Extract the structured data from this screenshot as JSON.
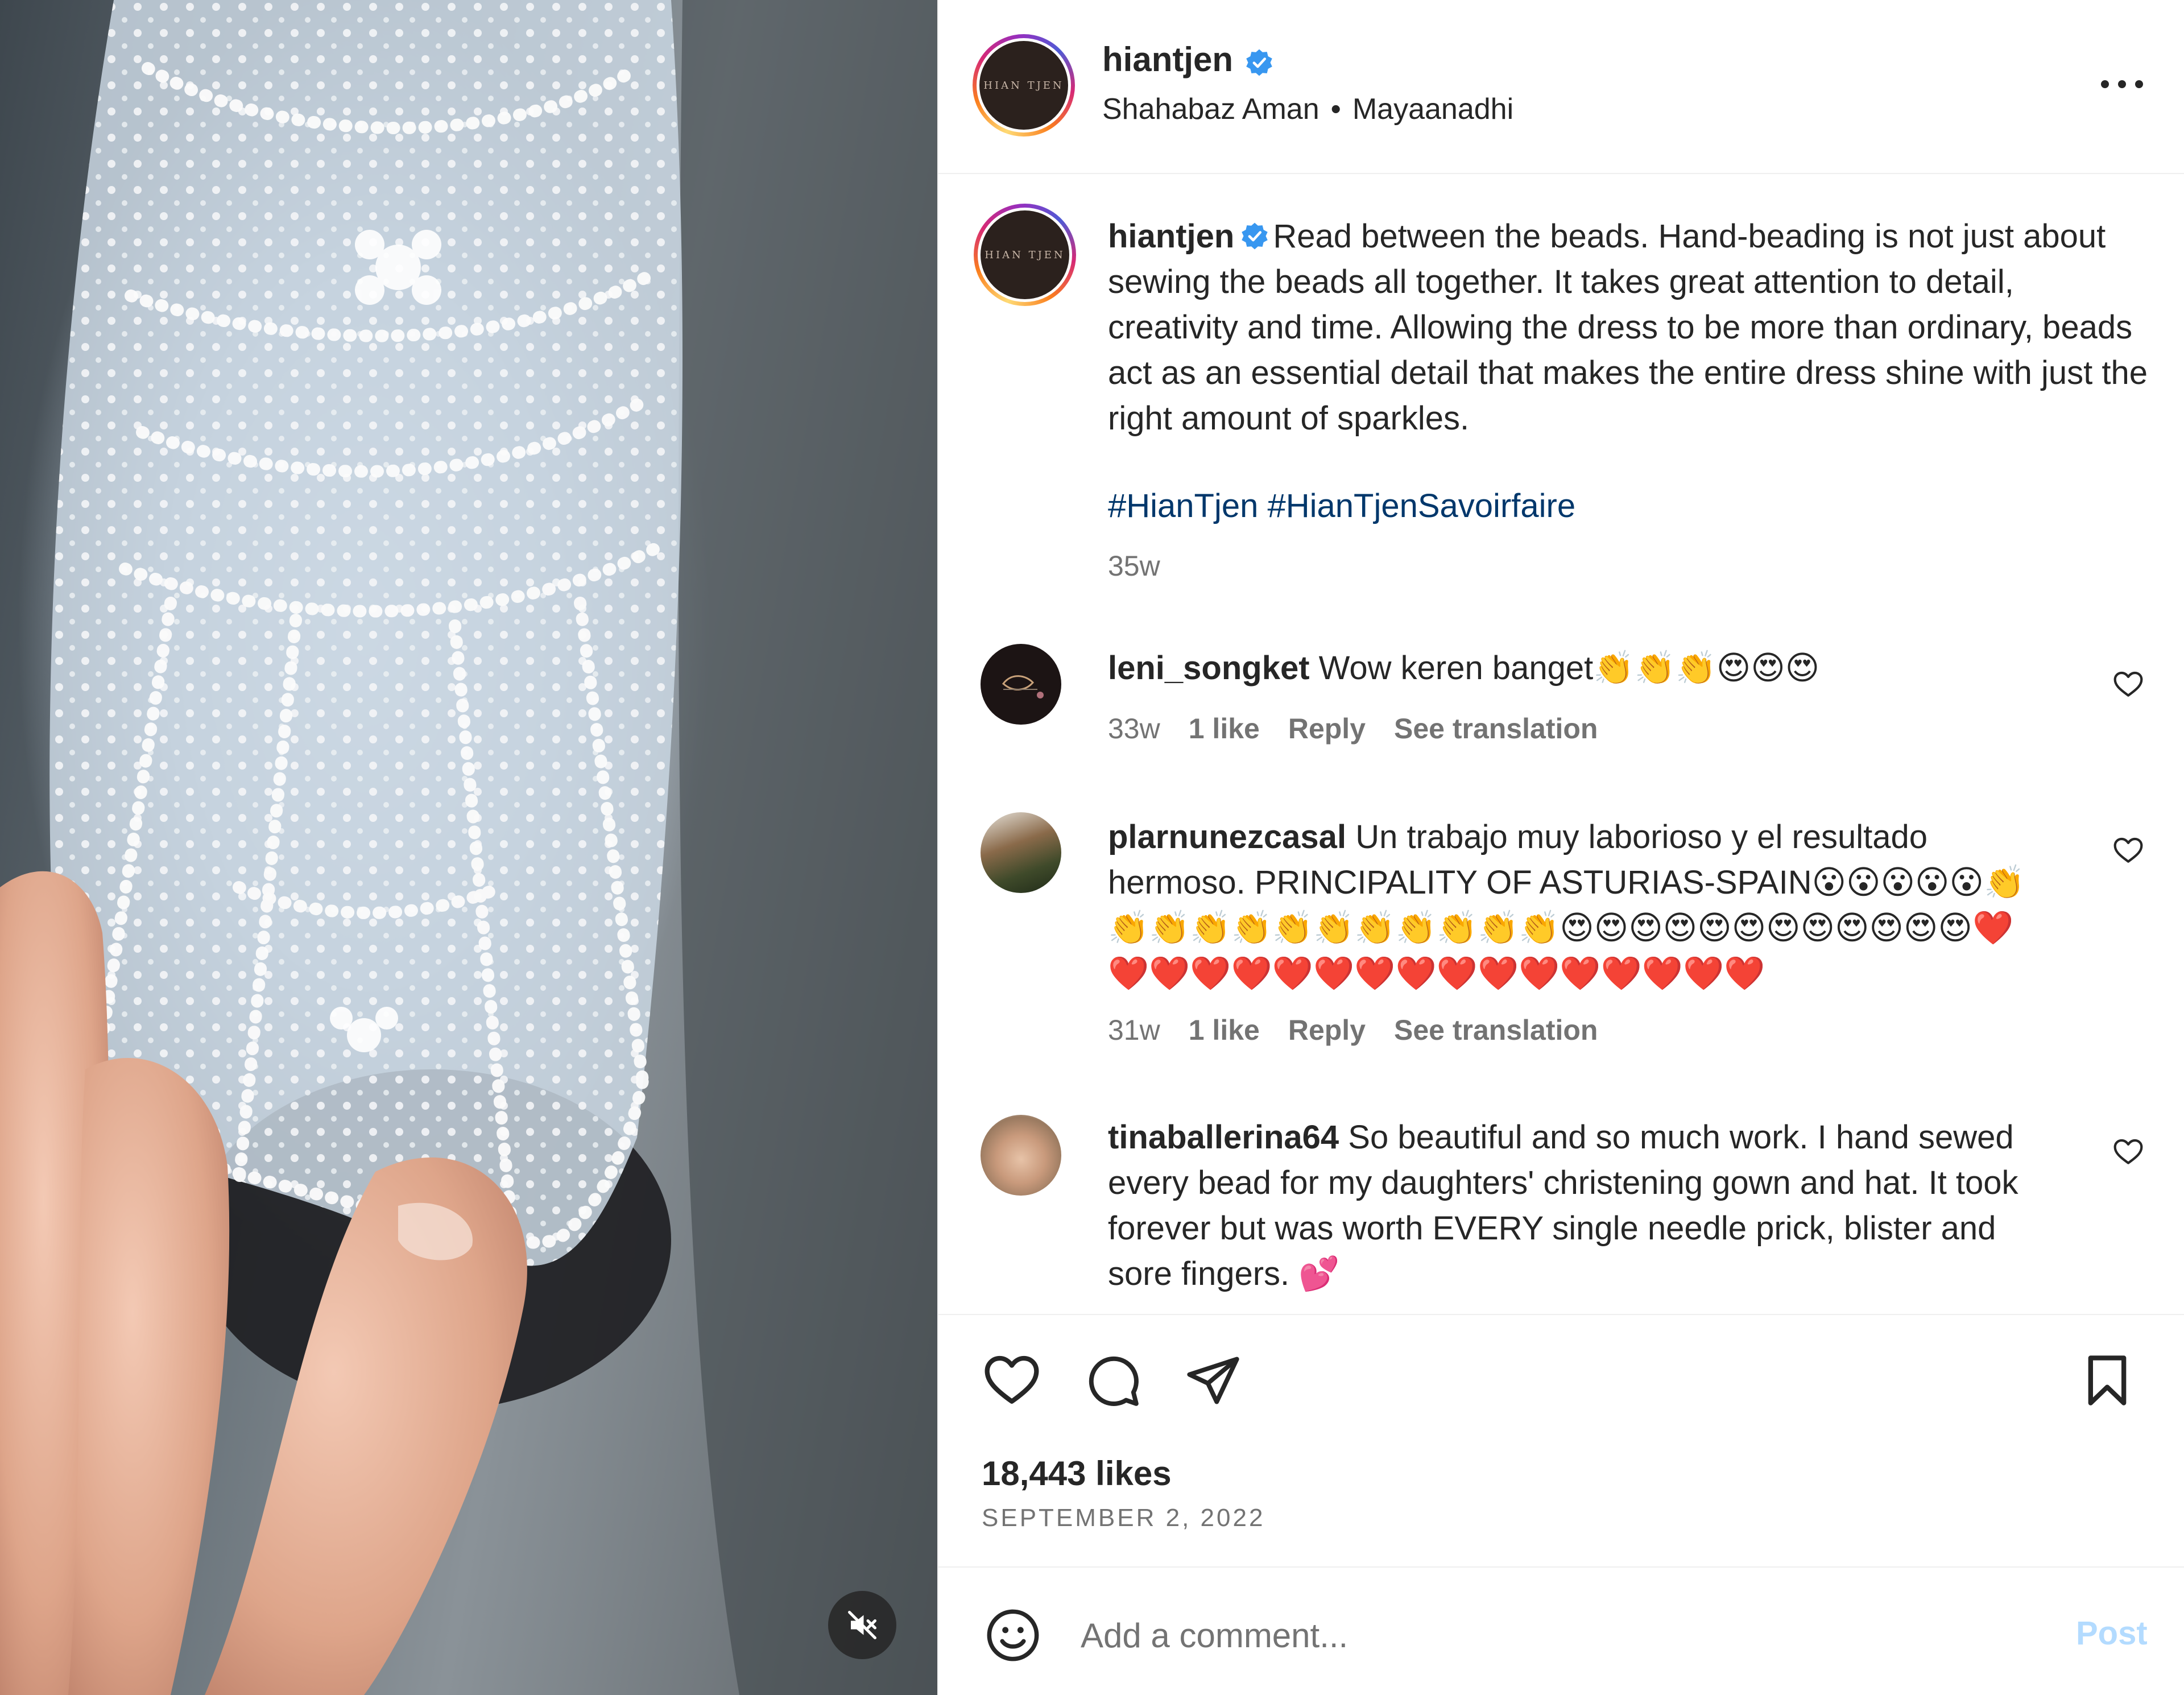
{
  "post": {
    "username": "hiantjen",
    "avatar_text": "HIAN TJEN",
    "audio_artist": "Shahabaz Aman",
    "audio_separator": "•",
    "audio_track": "Mayaanadhi",
    "caption": "Read between the beads. Hand-beading is not just about sewing the beads all together. It takes great attention to detail, creativity and time. Allowing the dress to be more than ordinary, beads act as an essential detail that makes the entire dress shine with just the right amount of sparkles.",
    "hashtags": "#HianTjen #HianTjenSavoirfaire",
    "time": "35w",
    "likes": "18,443 likes",
    "date": "SEPTEMBER 2, 2022"
  },
  "comments": [
    {
      "username": "leni_songket",
      "text": "Wow keren banget👏👏👏😍😍😍",
      "time": "33w",
      "likes": "1 like",
      "reply": "Reply",
      "translate": "See translation"
    },
    {
      "username": "plarnunezcasal",
      "text": "Un trabajo muy laborioso y el resultado hermoso. PRINCIPALITY OF ASTURIAS-SPAIN😮😮😮😮😮👏👏👏👏👏👏👏👏👏👏👏👏😍😍😍😍😍😍😍😍😍😍😍😍❤️❤️❤️❤️❤️❤️❤️❤️❤️❤️❤️❤️❤️❤️❤️❤️❤️",
      "time": "31w",
      "likes": "1 like",
      "reply": "Reply",
      "translate": "See translation"
    },
    {
      "username": "tinaballerina64",
      "text": "So beautiful and so much work. I hand sewed every bead for my daughters' christening gown and hat. It took forever but was worth EVERY single needle prick, blister and sore fingers. 💕"
    }
  ],
  "composer": {
    "placeholder": "Add a comment...",
    "post_label": "Post"
  },
  "colors": {
    "verified": "#3897f0",
    "hashtag": "#00376b",
    "post_button": "#b3dbff",
    "secondary_text": "#737373"
  },
  "icons": [
    "verified-badge-icon",
    "more-options-icon",
    "heart-icon",
    "comment-bubble-icon",
    "share-plane-icon",
    "bookmark-icon",
    "emoji-smiley-icon",
    "speaker-muted-icon"
  ]
}
